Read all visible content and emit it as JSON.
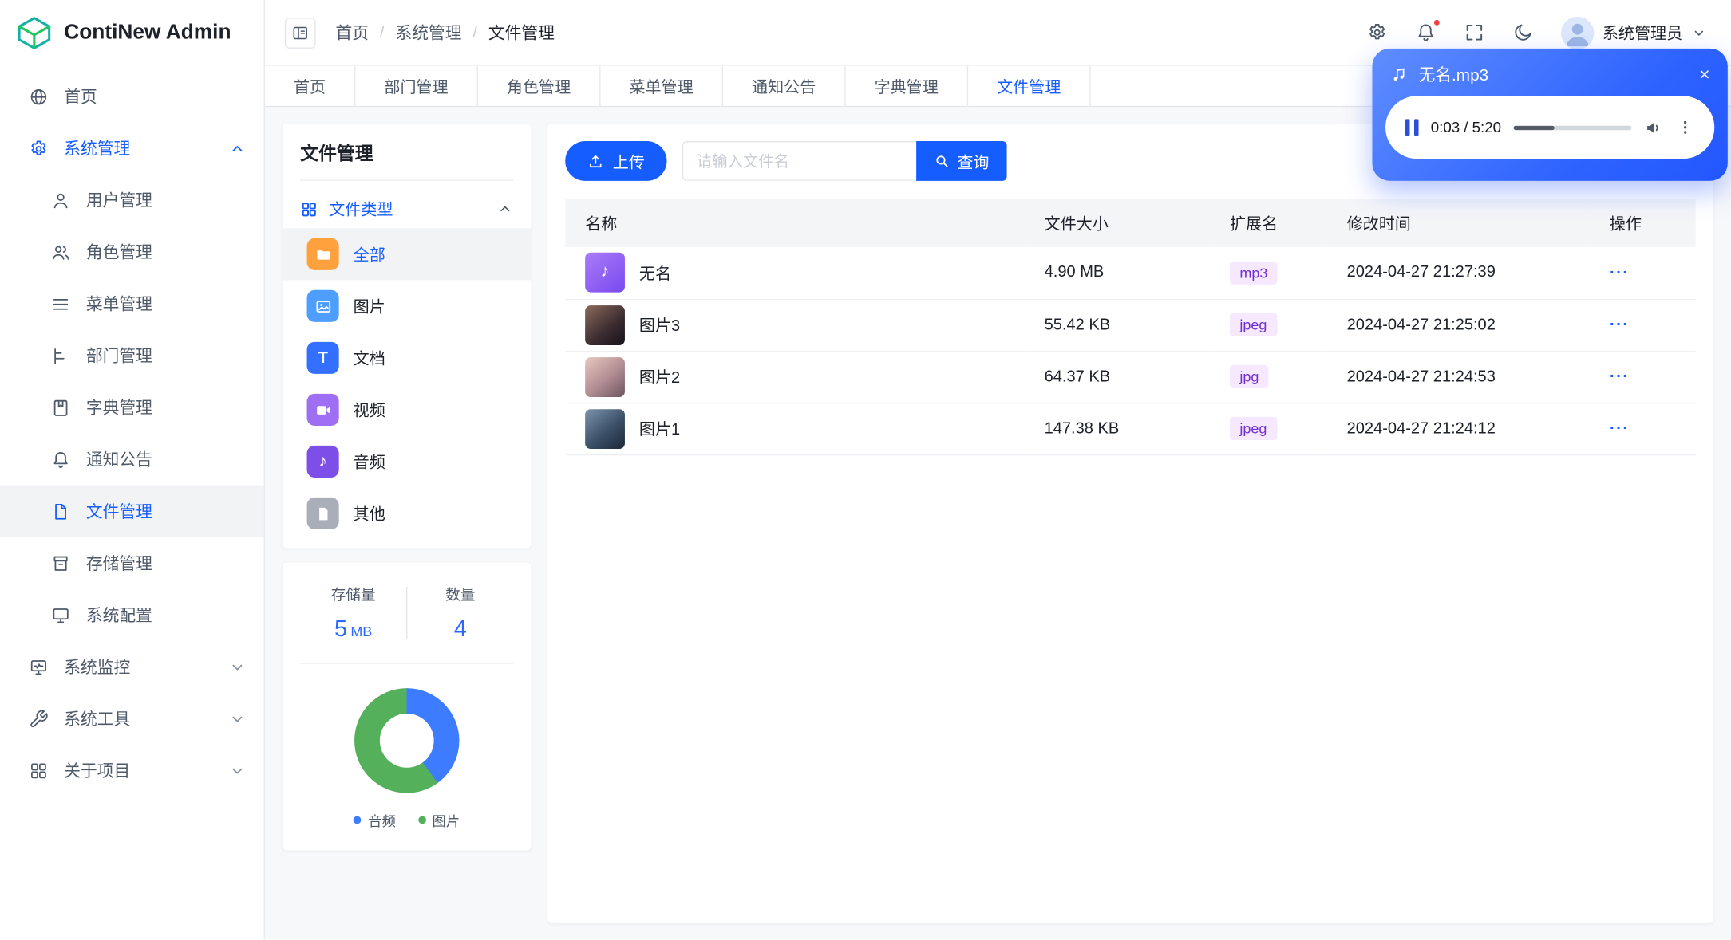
{
  "app": {
    "title": "ContiNew Admin"
  },
  "header": {
    "breadcrumb": [
      "首页",
      "系统管理",
      "文件管理"
    ],
    "separator": "/",
    "user": "系统管理员"
  },
  "tabs": [
    "首页",
    "部门管理",
    "角色管理",
    "菜单管理",
    "通知公告",
    "字典管理",
    "文件管理"
  ],
  "tabs_active": "文件管理",
  "sidebar": {
    "home": "首页",
    "system": {
      "label": "系统管理",
      "children": [
        "用户管理",
        "角色管理",
        "菜单管理",
        "部门管理",
        "字典管理",
        "通知公告",
        "文件管理",
        "存储管理",
        "系统配置"
      ]
    },
    "monitor": "系统监控",
    "tools": "系统工具",
    "about": "关于项目",
    "active_item": "文件管理"
  },
  "file_panel": {
    "title": "文件管理",
    "section_label": "文件类型",
    "types": [
      "全部",
      "图片",
      "文档",
      "视频",
      "音频",
      "其他"
    ],
    "active_type": "全部"
  },
  "stats": {
    "storage_label": "存储量",
    "storage_value": "5",
    "storage_unit": "MB",
    "count_label": "数量",
    "count_value": "4"
  },
  "chart_data": {
    "type": "pie",
    "labels": [
      "音频",
      "图片"
    ],
    "values": [
      40,
      60
    ],
    "unit": "percent (estimated from arc angles)",
    "colors": [
      "#3D7BFF",
      "#55B05C"
    ],
    "legend_position": "bottom",
    "donut": true
  },
  "toolbar": {
    "upload": "上传",
    "search_placeholder": "请输入文件名",
    "query": "查询"
  },
  "table": {
    "headers": [
      "名称",
      "文件大小",
      "扩展名",
      "修改时间",
      "操作"
    ],
    "more_label": "···",
    "rows": [
      {
        "name": "无名",
        "size": "4.90 MB",
        "ext": "mp3",
        "time": "2024-04-27 21:27:39"
      },
      {
        "name": "图片3",
        "size": "55.42 KB",
        "ext": "jpeg",
        "time": "2024-04-27 21:25:02"
      },
      {
        "name": "图片2",
        "size": "64.37 KB",
        "ext": "jpg",
        "time": "2024-04-27 21:24:53"
      },
      {
        "name": "图片1",
        "size": "147.38 KB",
        "ext": "jpeg",
        "time": "2024-04-27 21:24:12"
      }
    ]
  },
  "player": {
    "title": "无名.mp3",
    "time": "0:03 / 5:20",
    "progress_pct": 35,
    "close_label": "×"
  },
  "colors": {
    "primary": "#165DFF",
    "badge_bg": "#F5E8FF",
    "badge_text": "#722ED1"
  }
}
